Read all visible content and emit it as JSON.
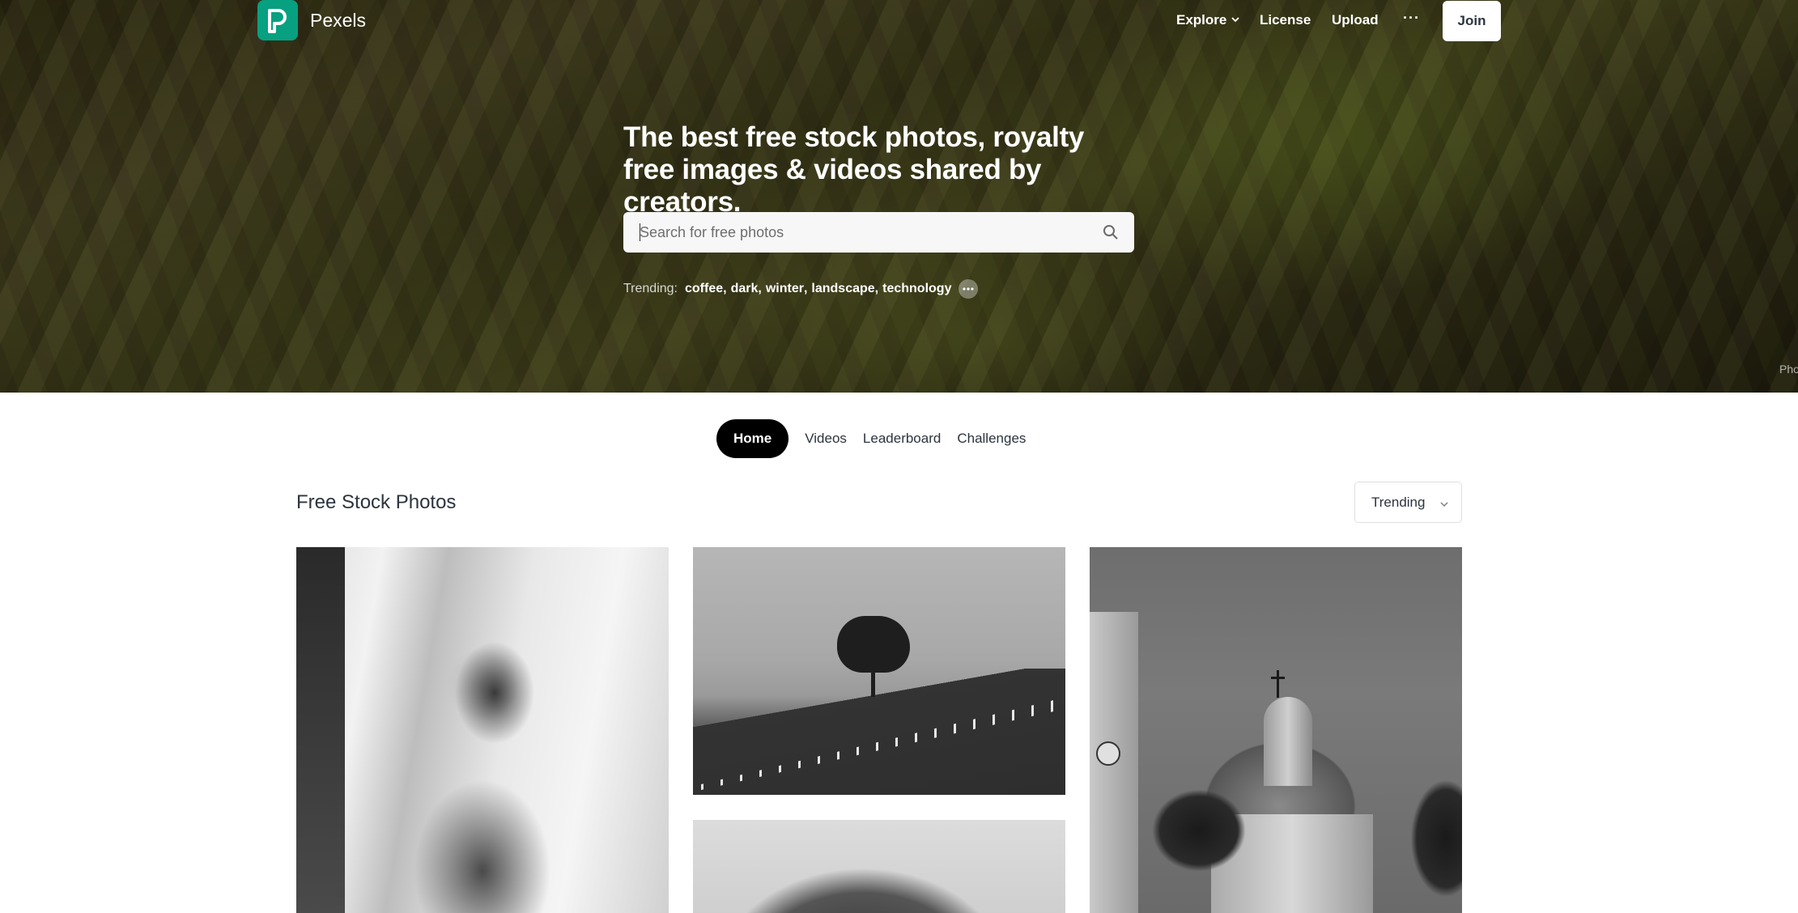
{
  "nav": {
    "brand": "Pexels",
    "links": {
      "explore": "Explore",
      "license": "License",
      "upload": "Upload"
    },
    "more": "···",
    "join": "Join"
  },
  "hero": {
    "title": "The best free stock photos, royalty free images & videos shared by creators.",
    "search": {
      "placeholder": "Search for free photos",
      "value": ""
    },
    "trending": {
      "label": "Trending:",
      "items": [
        "coffee",
        "dark",
        "winter",
        "landscape",
        "technology"
      ]
    },
    "credit": "Pho"
  },
  "tabs": [
    {
      "label": "Home",
      "active": true
    },
    {
      "label": "Videos",
      "active": false
    },
    {
      "label": "Leaderboard",
      "active": false
    },
    {
      "label": "Challenges",
      "active": false
    }
  ],
  "section": {
    "title": "Free Stock Photos",
    "sort": {
      "selected": "Trending"
    }
  },
  "colors": {
    "brand": "#07a081",
    "text": "#2c343e",
    "tab_active_bg": "#000000"
  },
  "icons": [
    "pexels-logo-icon",
    "chevron-down-icon",
    "more-icon",
    "search-icon"
  ]
}
